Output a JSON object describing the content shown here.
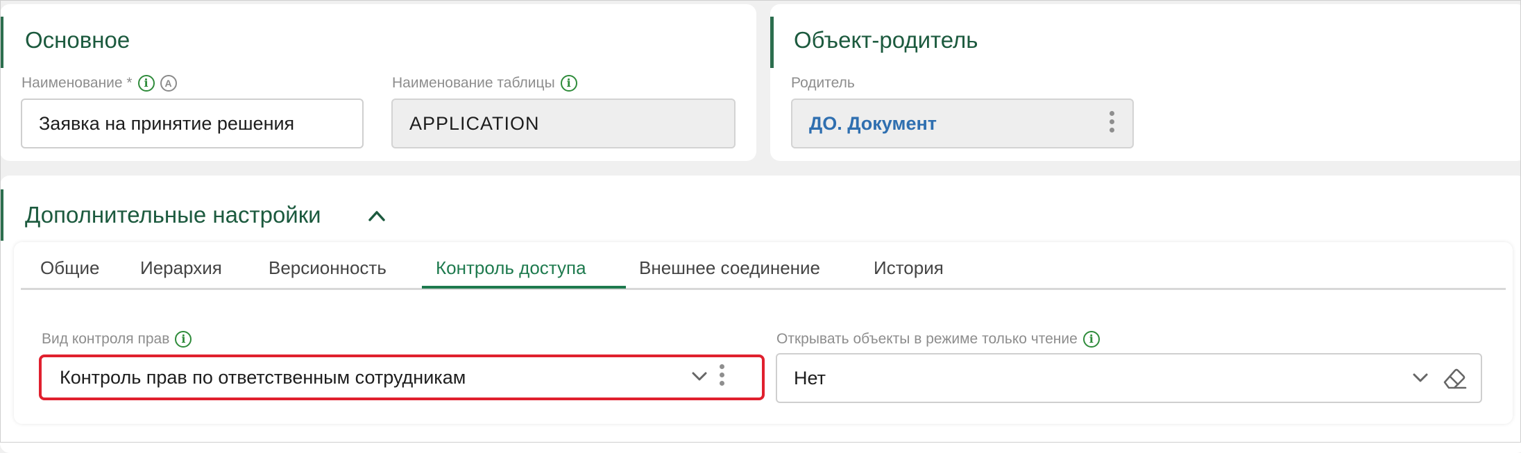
{
  "basic": {
    "title": "Основное",
    "name_label": "Наименование *",
    "name_value": "Заявка на принятие решения",
    "table_label": "Наименование таблицы",
    "table_value": "APPLICATION",
    "auto_icon_letter": "A",
    "info_icon_letter": "i"
  },
  "parent": {
    "title": "Объект-родитель",
    "label": "Родитель",
    "value": "ДО. Документ"
  },
  "extra": {
    "title": "Дополнительные настройки",
    "tabs": [
      {
        "label": "Общие"
      },
      {
        "label": "Иерархия"
      },
      {
        "label": "Версионность"
      },
      {
        "label": "Контроль доступа"
      },
      {
        "label": "Внешнее соединение"
      },
      {
        "label": "История"
      }
    ],
    "active_tab_index": 3,
    "rights_label": "Вид контроля прав",
    "rights_value": "Контроль прав по ответственным сотрудникам",
    "readonly_label": "Открывать объекты в режиме только чтение",
    "readonly_value": "Нет"
  },
  "colors": {
    "accent": "#2c6e4e",
    "title": "#1c5a3e",
    "active_tab": "#1e7a4e",
    "info_icon": "#2e8b3a",
    "highlight_border": "#e0202e",
    "link_value": "#2f6fb0"
  }
}
